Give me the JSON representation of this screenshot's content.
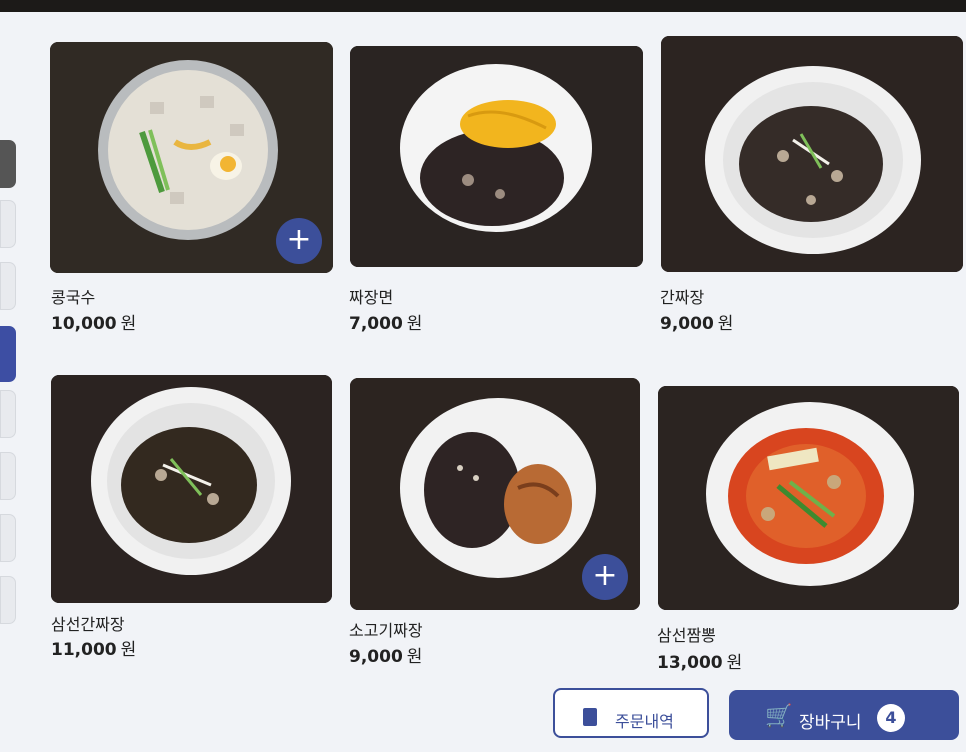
{
  "menu": [
    {
      "name": "콩국수",
      "price": "10,000",
      "unit": "원",
      "image": "kongguksu"
    },
    {
      "name": "짜장면",
      "price": "7,000",
      "unit": "원",
      "image": "jjajangmyeon"
    },
    {
      "name": "간짜장",
      "price": "9,000",
      "unit": "원",
      "image": "ganjjajang"
    },
    {
      "name": "삼선간짜장",
      "price": "11,000",
      "unit": "원",
      "image": "samseon-ganjjajang"
    },
    {
      "name": "소고기짜장",
      "price": "9,000",
      "unit": "원",
      "image": "sogogi-jjajang"
    },
    {
      "name": "삼선짬뽕",
      "price": "13,000",
      "unit": "원",
      "image": "samseon-jjamppong"
    }
  ],
  "add_symbol": "+",
  "footer": {
    "history_label": "주문내역",
    "cart_label": "장바구니",
    "cart_count": "4"
  },
  "colors": {
    "accent": "#3c4f9a",
    "background": "#f1f3f7"
  }
}
